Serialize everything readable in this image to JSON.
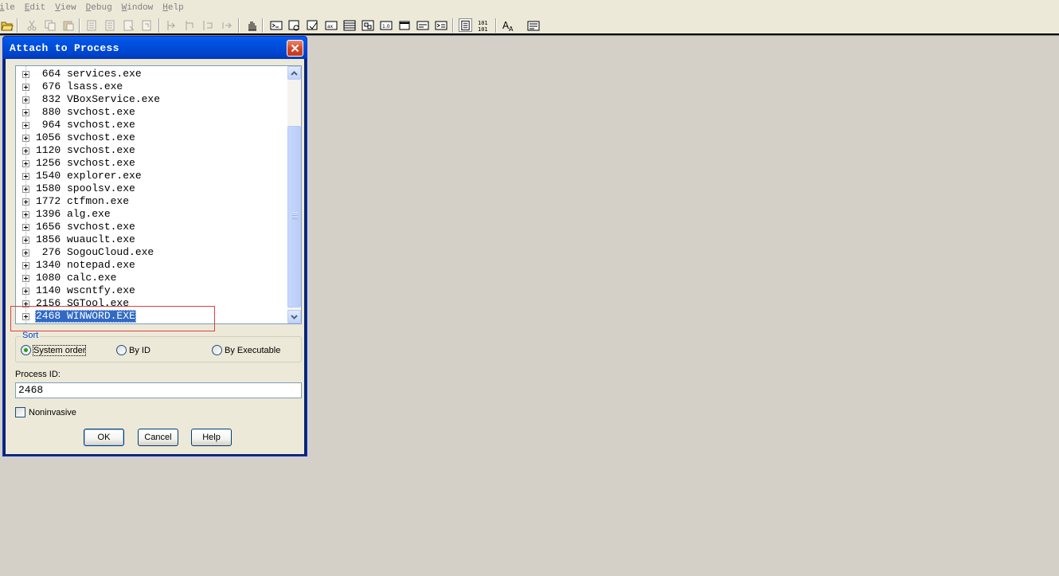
{
  "menubar": {
    "items": [
      "ile",
      "Edit",
      "View",
      "Debug",
      "Window",
      "Help"
    ]
  },
  "toolbar": {
    "buttons": [
      "open-icon",
      "cut-icon",
      "copy-icon",
      "paste-icon",
      "undo-icon",
      "redo-icon",
      "find-icon",
      "find-next-icon",
      "step-into-icon",
      "step-over-icon",
      "step-out-icon",
      "run-to-cursor-icon",
      "hand-icon",
      "command-window-icon",
      "watch-icon",
      "locals-icon",
      "registers-icon",
      "call-stack-icon",
      "disassembly-icon",
      "memory-icon",
      "scratch-pad-icon",
      "processes-icon",
      "source-mode-icon",
      "hex-mode-icon",
      "font-icon",
      "options-icon"
    ]
  },
  "dialog": {
    "title": "Attach to Process",
    "processes": [
      {
        "pid": " 664",
        "name": "services.exe"
      },
      {
        "pid": " 676",
        "name": "lsass.exe"
      },
      {
        "pid": " 832",
        "name": "VBoxService.exe"
      },
      {
        "pid": " 880",
        "name": "svchost.exe"
      },
      {
        "pid": " 964",
        "name": "svchost.exe"
      },
      {
        "pid": "1056",
        "name": "svchost.exe"
      },
      {
        "pid": "1120",
        "name": "svchost.exe"
      },
      {
        "pid": "1256",
        "name": "svchost.exe"
      },
      {
        "pid": "1540",
        "name": "explorer.exe"
      },
      {
        "pid": "1580",
        "name": "spoolsv.exe"
      },
      {
        "pid": "1772",
        "name": "ctfmon.exe"
      },
      {
        "pid": "1396",
        "name": "alg.exe"
      },
      {
        "pid": "1656",
        "name": "svchost.exe"
      },
      {
        "pid": "1856",
        "name": "wuauclt.exe"
      },
      {
        "pid": " 276",
        "name": "SogouCloud.exe"
      },
      {
        "pid": "1340",
        "name": "notepad.exe"
      },
      {
        "pid": "1080",
        "name": "calc.exe"
      },
      {
        "pid": "1140",
        "name": "wscntfy.exe"
      },
      {
        "pid": "2156",
        "name": "SGTool.exe"
      },
      {
        "pid": "2468",
        "name": "WINWORD.EXE",
        "selected": true
      }
    ],
    "sort": {
      "label": "Sort",
      "options": [
        {
          "label": "System order",
          "checked": true
        },
        {
          "label": "By ID",
          "checked": false
        },
        {
          "label": "By Executable",
          "checked": false
        }
      ]
    },
    "process_id_label": "Process ID:",
    "process_id_value": "2468",
    "noninvasive_label": "Noninvasive",
    "noninvasive_checked": false,
    "buttons": {
      "ok": "OK",
      "cancel": "Cancel",
      "help": "Help"
    }
  }
}
